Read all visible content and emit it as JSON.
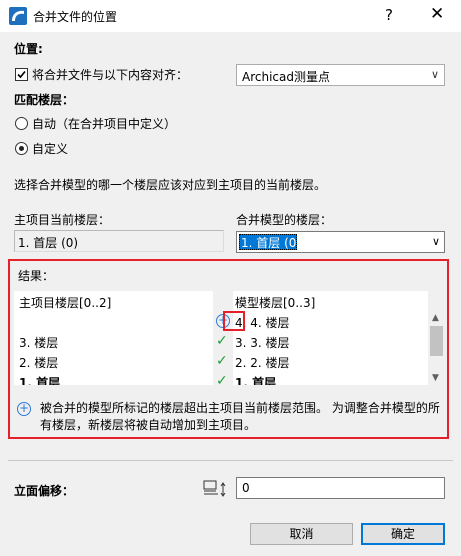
{
  "window": {
    "title": "合并文件的位置",
    "help_glyph": "?",
    "close_glyph": "✕"
  },
  "position": {
    "heading": "位置:",
    "align_checkbox_label": "将合并文件与以下内容对齐：",
    "align_checked": true,
    "align_target": "Archicad测量点"
  },
  "match_floors": {
    "heading": "匹配楼层：",
    "option_auto": "自动（在合并项目中定义）",
    "option_custom": "自定义",
    "selected": "custom",
    "description": "选择合并模型的哪一个楼层应该对应到主项目的当前楼层。"
  },
  "host_floor": {
    "label": "主项目当前楼层：",
    "value": "1. 首层 (0)"
  },
  "merged_floor": {
    "label": "合并模型的楼层：",
    "value": "1. 首层 (0)"
  },
  "result": {
    "heading": "结果：",
    "col_host": "主项目楼层[0..2]",
    "col_model": "模型楼层[0..3]",
    "rows": [
      {
        "host": "",
        "status": "add",
        "model": "4. 4. 楼层",
        "bold": false
      },
      {
        "host": "3. 楼层",
        "status": "match",
        "model": "3. 3. 楼层",
        "bold": false
      },
      {
        "host": "2. 楼层",
        "status": "match",
        "model": "2. 2. 楼层",
        "bold": false
      },
      {
        "host": "1. 首层",
        "status": "match",
        "model": "1. 首层",
        "bold": true
      }
    ],
    "status_glyphs": {
      "add": "+",
      "match": "✓"
    },
    "info": "被合并的模型所标记的楼层超出主项目当前楼层范围。 为调整合并模型的所有楼层，新楼层将被自动增加到主项目。"
  },
  "elevation": {
    "label": "立面偏移：",
    "value": "0"
  },
  "buttons": {
    "cancel": "取消",
    "ok": "确定"
  },
  "colors": {
    "highlight_red": "#e5202a",
    "accent_blue": "#0078d7",
    "check_green": "#1e9e3a"
  }
}
